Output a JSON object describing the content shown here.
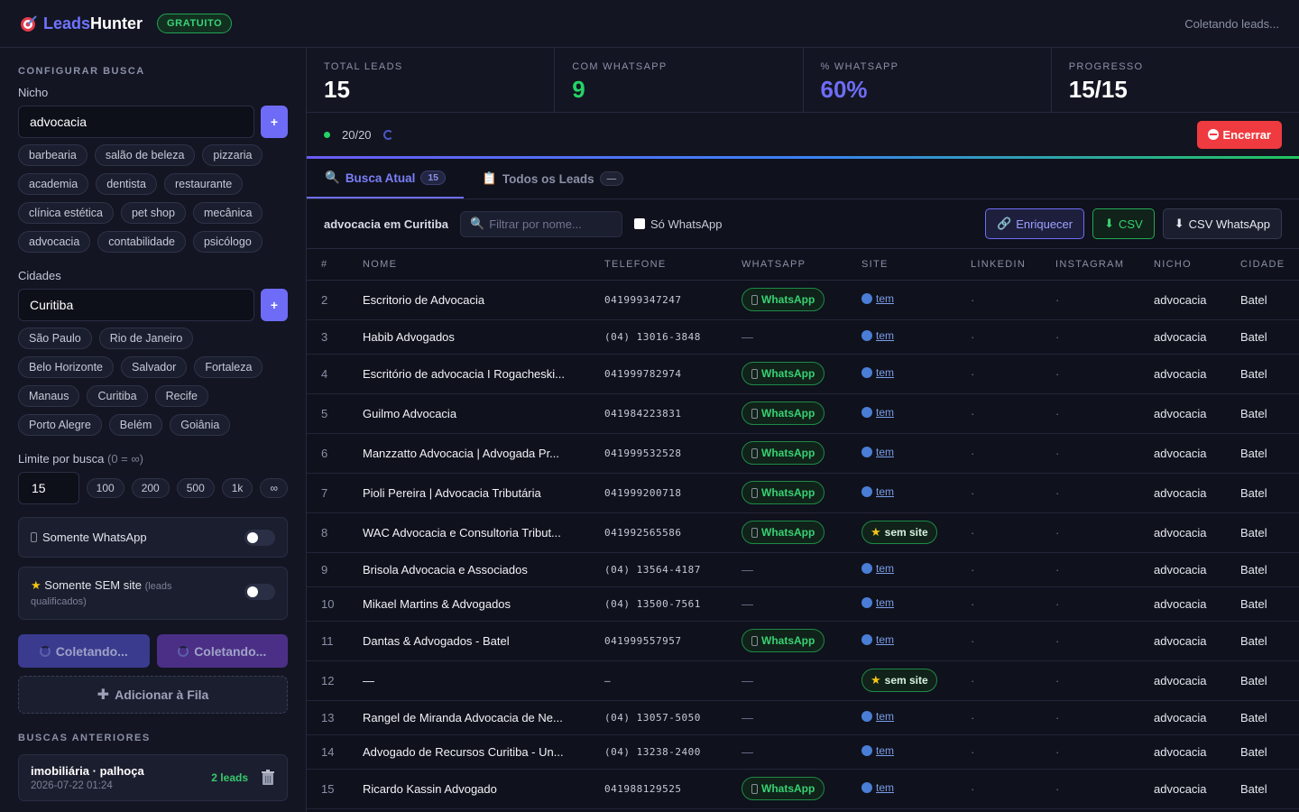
{
  "header": {
    "logo_part1": "Leads",
    "logo_part2": "Hunter",
    "plan_badge": "GRATUITO",
    "status": "Coletando leads..."
  },
  "sidebar": {
    "section_title": "CONFIGURAR BUSCA",
    "niche_label": "Nicho",
    "niche_value": "advocacia",
    "add_symbol": "+",
    "niche_chips": [
      "barbearia",
      "salão de beleza",
      "pizzaria",
      "academia",
      "dentista",
      "restaurante",
      "clínica estética",
      "pet shop",
      "mecânica",
      "advocacia",
      "contabilidade",
      "psicólogo"
    ],
    "cities_label": "Cidades",
    "city_value": "Curitiba",
    "city_chips": [
      "São Paulo",
      "Rio de Janeiro",
      "Belo Horizonte",
      "Salvador",
      "Fortaleza",
      "Manaus",
      "Curitiba",
      "Recife",
      "Porto Alegre",
      "Belém",
      "Goiânia"
    ],
    "limit_label": "Limite por busca",
    "limit_hint": "(0 = ∞)",
    "limit_value": "15",
    "limit_chips": [
      "100",
      "200",
      "500",
      "1k",
      "∞"
    ],
    "toggle_whatsapp": "Somente WhatsApp",
    "toggle_no_site": "Somente SEM site",
    "toggle_no_site_hint_1": "(leads",
    "toggle_no_site_hint_2": "qualificados)",
    "collect_btn_1": "Coletando...",
    "collect_btn_2": "Coletando...",
    "queue_btn": "Adicionar à Fila",
    "previous_title": "BUSCAS ANTERIORES",
    "previous": [
      {
        "title": "imobiliária · palhoça",
        "date": "2026-07-22 01:24",
        "count": "2 leads"
      }
    ]
  },
  "stats": [
    {
      "label": "TOTAL LEADS",
      "value": "15",
      "color": "#ffffff"
    },
    {
      "label": "COM WHATSAPP",
      "value": "9",
      "color": "#25d366"
    },
    {
      "label": "% WHATSAPP",
      "value": "60%",
      "color": "#6e6cf6"
    },
    {
      "label": "PROGRESSO",
      "value": "15/15",
      "color": "#ffffff"
    }
  ],
  "progress": {
    "text": "20/20",
    "stop_label": "Encerrar"
  },
  "tabs": [
    {
      "label": "Busca Atual",
      "count": "15"
    },
    {
      "label": "Todos os Leads",
      "count": "—"
    }
  ],
  "filter": {
    "query": "advocacia em Curitiba",
    "placeholder": "Filtrar por nome...",
    "only_whatsapp": "Só WhatsApp",
    "enrich_btn": "Enriquecer",
    "csv_btn": "CSV",
    "csv_wa_btn": "CSV WhatsApp"
  },
  "table": {
    "columns": [
      "#",
      "NOME",
      "TELEFONE",
      "WHATSAPP",
      "SITE",
      "LINKEDIN",
      "INSTAGRAM",
      "NICHO",
      "CIDADE"
    ],
    "wa_label": "WhatsApp",
    "site_label": "tem",
    "no_site_label": "sem site",
    "dash": "—",
    "dot": "·",
    "rows": [
      {
        "n": "2",
        "name": "Escritorio de Advocacia",
        "tel": "041999347247",
        "wa": true,
        "site": "tem",
        "niche": "advocacia",
        "city": "Batel"
      },
      {
        "n": "3",
        "name": "Habib Advogados",
        "tel": "(04) 13016-3848",
        "wa": false,
        "site": "tem",
        "niche": "advocacia",
        "city": "Batel"
      },
      {
        "n": "4",
        "name": "Escritório de advocacia I Rogacheski...",
        "tel": "041999782974",
        "wa": true,
        "site": "tem",
        "niche": "advocacia",
        "city": "Batel"
      },
      {
        "n": "5",
        "name": "Guilmo Advocacia",
        "tel": "041984223831",
        "wa": true,
        "site": "tem",
        "niche": "advocacia",
        "city": "Batel"
      },
      {
        "n": "6",
        "name": "Manzzatto Advocacia | Advogada Pr...",
        "tel": "041999532528",
        "wa": true,
        "site": "tem",
        "niche": "advocacia",
        "city": "Batel"
      },
      {
        "n": "7",
        "name": "Pioli Pereira | Advocacia Tributária",
        "tel": "041999200718",
        "wa": true,
        "site": "tem",
        "niche": "advocacia",
        "city": "Batel"
      },
      {
        "n": "8",
        "name": "WAC Advocacia e Consultoria Tribut...",
        "tel": "041992565586",
        "wa": true,
        "site": "sem",
        "niche": "advocacia",
        "city": "Batel"
      },
      {
        "n": "9",
        "name": "Brisola Advocacia e Associados",
        "tel": "(04) 13564-4187",
        "wa": false,
        "site": "tem",
        "niche": "advocacia",
        "city": "Batel"
      },
      {
        "n": "10",
        "name": "Mikael Martins & Advogados",
        "tel": "(04) 13500-7561",
        "wa": false,
        "site": "tem",
        "niche": "advocacia",
        "city": "Batel"
      },
      {
        "n": "11",
        "name": "Dantas & Advogados - Batel",
        "tel": "041999557957",
        "wa": true,
        "site": "tem",
        "niche": "advocacia",
        "city": "Batel"
      },
      {
        "n": "12",
        "name": "—",
        "tel": "—",
        "wa": false,
        "site": "sem",
        "niche": "advocacia",
        "city": "Batel"
      },
      {
        "n": "13",
        "name": "Rangel de Miranda Advocacia de Ne...",
        "tel": "(04) 13057-5050",
        "wa": false,
        "site": "tem",
        "niche": "advocacia",
        "city": "Batel"
      },
      {
        "n": "14",
        "name": "Advogado de Recursos Curitiba - Un...",
        "tel": "(04) 13238-2400",
        "wa": false,
        "site": "tem",
        "niche": "advocacia",
        "city": "Batel"
      },
      {
        "n": "15",
        "name": "Ricardo Kassin Advogado",
        "tel": "041988129525",
        "wa": true,
        "site": "tem",
        "niche": "advocacia",
        "city": "Batel"
      }
    ]
  }
}
